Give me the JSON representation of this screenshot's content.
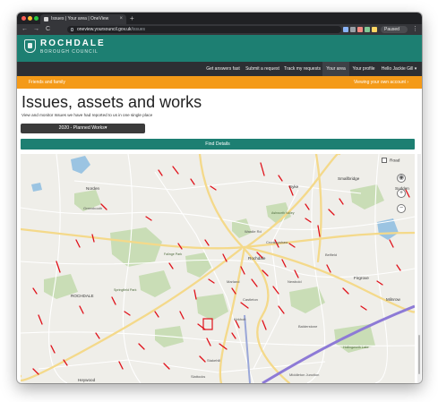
{
  "browser": {
    "tab_title": "Issues | Your area | OneView",
    "tab_close": "×",
    "new_tab": "+",
    "back": "←",
    "forward": "→",
    "reload": "C",
    "url_domain": "oneview.yoursouncil.gov.uk",
    "url_path": "/issues",
    "paused_label": "Paused",
    "menu": "⋮",
    "dots": [
      "#ff5f57",
      "#febc2e",
      "#28c840"
    ],
    "ext_colors": [
      "#8ab4f8",
      "#9aa0a6",
      "#f28b82",
      "#81c995",
      "#fdd663"
    ]
  },
  "site": {
    "brand": "ROCHDALE",
    "brand_sub": "BOROUGH COUNCIL",
    "nav": [
      {
        "label": "Get answers fast"
      },
      {
        "label": "Submit a request"
      },
      {
        "label": "Track my requests"
      },
      {
        "label": "Your area"
      },
      {
        "label": "Your profile"
      },
      {
        "label": "Hello Jackie Gill ▾"
      }
    ],
    "subbar_left": "Friends and family",
    "subbar_right": "Viewing your own account ›"
  },
  "page": {
    "title": "Issues, assets and works",
    "description": "View and monitor Issues we have had reported to us in one single place",
    "select_value": "2020 - Planned Works",
    "find_button": "Find Details"
  },
  "map": {
    "road_label": "Road",
    "locate": "◉",
    "zoom_in": "+",
    "zoom_out": "−",
    "towns": [
      "Norden",
      "Sudden",
      "Syke",
      "Smallbridge",
      "Rochdale",
      "ROCHDALE",
      "Firgrove",
      "Milnrow",
      "Heywood",
      "Slattocks",
      "Middleton Junction"
    ],
    "place_labels": [
      "Greenbooth",
      "Ashworth Valley",
      "Falinge Park",
      "Springfield Park",
      "Marland",
      "Castleton",
      "Kirkholt",
      "Balderstone",
      "Belfield",
      "Newbold",
      "Wardle Rd",
      "Cronkeyshaw",
      "Hollingworth Lake",
      "Stakehill"
    ],
    "colors": {
      "land": "#efeee9",
      "green": "#c9ddb6",
      "water": "#9bc4e2",
      "major_road": "#f4d98a",
      "motorway": "#8d7ad6",
      "issue": "#e0111a"
    }
  }
}
